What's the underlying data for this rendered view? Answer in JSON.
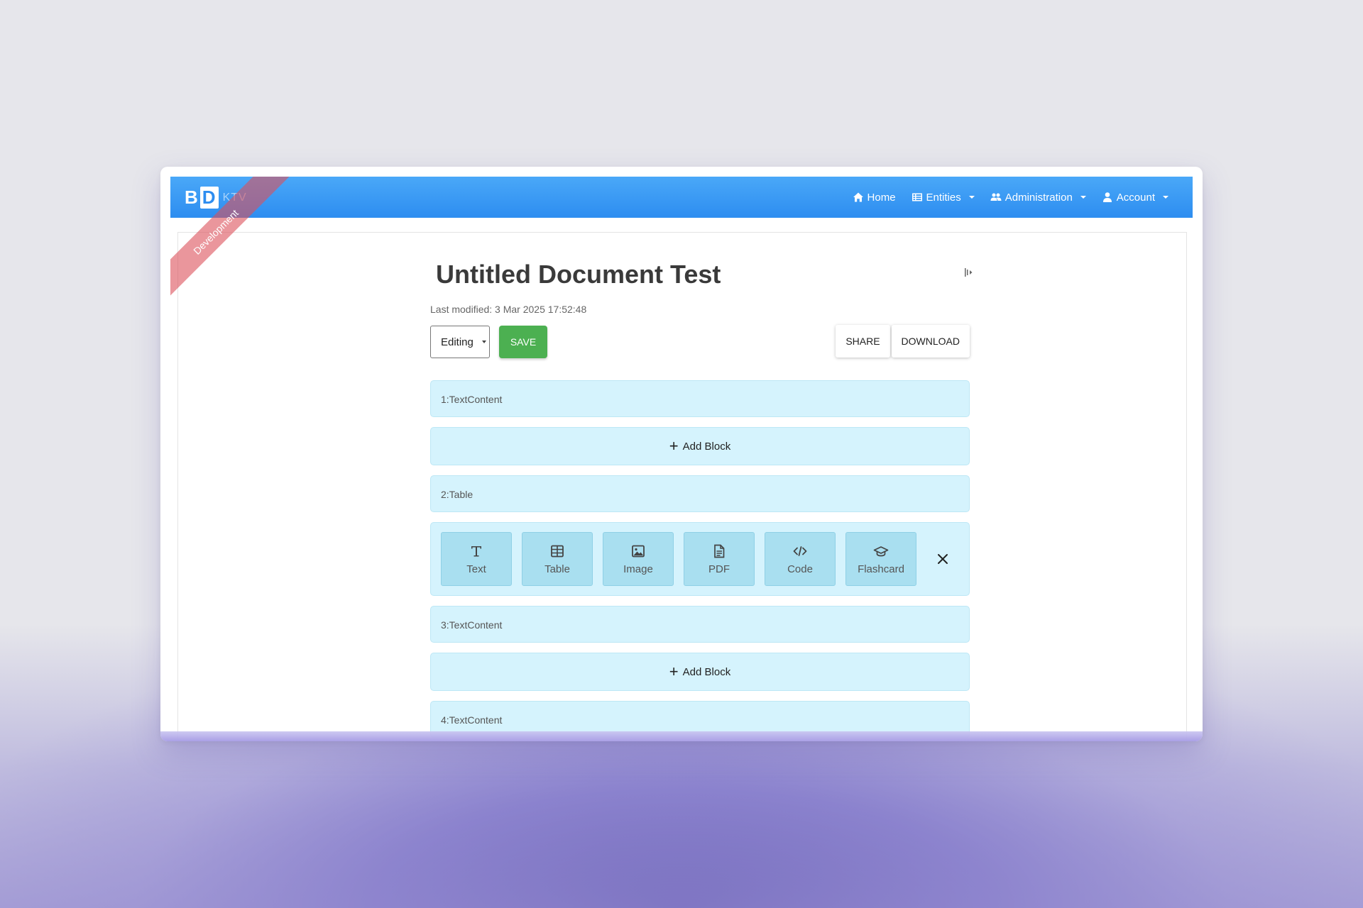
{
  "brand": {
    "logo": "BD",
    "version": "KTV"
  },
  "ribbon": {
    "label": "Development"
  },
  "nav": {
    "home": "Home",
    "entities": "Entities",
    "administration": "Administration",
    "account": "Account"
  },
  "document": {
    "title": "Untitled Document Test",
    "last_modified": "Last modified: 3 Mar 2025 17:52:48"
  },
  "toolbar": {
    "mode_value": "Editing",
    "save_label": "SAVE",
    "share_label": "SHARE",
    "download_label": "DOWNLOAD"
  },
  "blocks": {
    "block1": "1:TextContent",
    "add_block_label": "Add Block",
    "block2": "2:Table",
    "block3": "3:TextContent",
    "block4": "4:TextContent"
  },
  "picker": {
    "text": "Text",
    "table": "Table",
    "image": "Image",
    "pdf": "PDF",
    "code": "Code",
    "flashcard": "Flashcard"
  },
  "colors": {
    "navbar": "#2d8df0",
    "save": "#4cb051",
    "block_bg": "#d5f3fd",
    "picker_tile": "#a9dff0",
    "ribbon": "#dc505a"
  }
}
